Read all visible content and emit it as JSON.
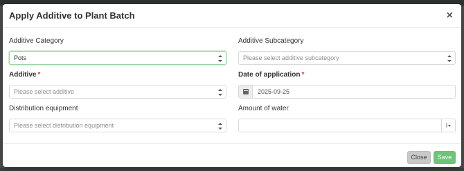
{
  "modal": {
    "title": "Apply Additive to Plant Batch",
    "close_glyph": "×"
  },
  "fields": {
    "category": {
      "label": "Additive Category",
      "value": "Pots"
    },
    "subcategory": {
      "label": "Additive Subcategory",
      "placeholder": "Please select additive subcategory"
    },
    "additive": {
      "label": "Additive",
      "required_mark": "*",
      "placeholder": "Please select additive"
    },
    "date": {
      "label": "Date of application",
      "required_mark": "*",
      "value": "2025-09-25",
      "icon": "calendar-icon"
    },
    "equipment": {
      "label": "Distribution equipment",
      "placeholder": "Please select distribution equipment"
    },
    "water": {
      "label": "Amount of water",
      "value": "",
      "unit": "l"
    }
  },
  "footer": {
    "close_label": "Close",
    "save_label": "Save"
  },
  "colors": {
    "save_green": "#6fc279",
    "focus_green": "#9fd4a3",
    "close_gray": "#c7cac8"
  }
}
